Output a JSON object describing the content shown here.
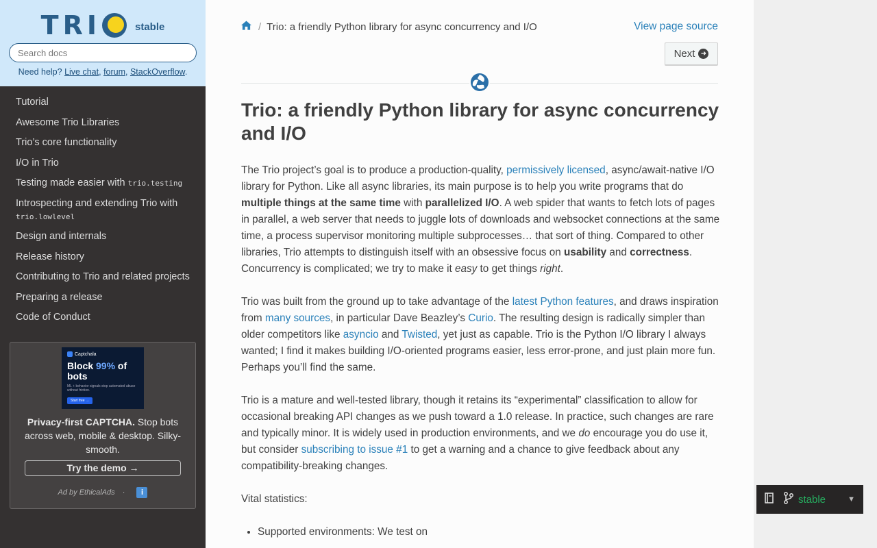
{
  "sidebar": {
    "logo_text": "TRI",
    "version": "stable",
    "search_placeholder": "Search docs",
    "help": {
      "prefix": "Need help?",
      "live_chat": "Live chat",
      "forum": "forum",
      "stackoverflow": "StackOverflow",
      "suffix": "."
    },
    "nav": [
      {
        "label": "Tutorial"
      },
      {
        "label": "Awesome Trio Libraries"
      },
      {
        "label": "Trio’s core functionality"
      },
      {
        "label": "I/O in Trio"
      },
      {
        "label": "Testing made easier with ",
        "code": "trio.testing"
      },
      {
        "label": "Introspecting and extending Trio with",
        "code": "trio.lowlevel"
      },
      {
        "label": "Design and internals"
      },
      {
        "label": "Release history"
      },
      {
        "label": "Contributing to Trio and related projects"
      },
      {
        "label": "Preparing a release"
      },
      {
        "label": "Code of Conduct"
      }
    ],
    "ad": {
      "image_brand": "Captchala",
      "image_headline_1": "Block ",
      "image_headline_hl": "99%",
      "image_headline_2": " of bots",
      "image_small": "ML + behavior signals stop automated abuse without friction.",
      "image_cta": "Start free →",
      "bold": "Privacy-first CAPTCHA.",
      "text": " Stop bots across web, mobile & desktop. Silky-smooth.",
      "button": "Try the demo →",
      "footer": "Ad by EthicalAds",
      "dot": "·",
      "info": "i"
    }
  },
  "content": {
    "breadcrumb": {
      "home_icon": "home-icon",
      "separator": "/",
      "current": "Trio: a friendly Python library for async concurrency and I/O"
    },
    "view_source": "View page source",
    "next": "Next",
    "title": "Trio: a friendly Python library for async concurrency and I/O",
    "p1": {
      "a": "The Trio project’s goal is to produce a production-quality, ",
      "link1": "permissively licensed",
      "b": ", async/await-native I/O library for Python. Like all async libraries, its main purpose is to help you write programs that do ",
      "bold1": "multiple things at the same time",
      "c": " with ",
      "bold2": "parallelized I/O",
      "d": ". A web spider that wants to fetch lots of pages in parallel, a web server that needs to juggle lots of downloads and websocket connections at the same time, a process supervisor monitoring multiple subprocesses… that sort of thing. Compared to other libraries, Trio attempts to distinguish itself with an obsessive focus on ",
      "bold3": "usability",
      "e": " and ",
      "bold4": "correctness",
      "f": ". Concurrency is complicated; we try to make it ",
      "em1": "easy",
      "g": " to get things ",
      "em2": "right",
      "h": "."
    },
    "p2": {
      "a": "Trio was built from the ground up to take advantage of the ",
      "link1": "latest Python features",
      "b": ", and draws inspiration from ",
      "link2": "many sources",
      "c": ", in particular Dave Beazley’s ",
      "link3": "Curio",
      "d": ". The resulting design is radically simpler than older competitors like ",
      "link4": "asyncio",
      "e": " and ",
      "link5": "Twisted",
      "f": ", yet just as capable. Trio is the Python I/O library I always wanted; I find it makes building I/O-oriented programs easier, less error-prone, and just plain more fun. Perhaps you’ll find the same."
    },
    "p3": {
      "a": "Trio is a mature and well-tested library, though it retains its “experimental” classification to allow for occasional breaking API changes as we push toward a 1.0 release. In practice, such changes are rare and typically minor. It is widely used in production environments, and we ",
      "em1": "do",
      "b": " encourage you do use it, but consider ",
      "link1": "subscribing to issue #1",
      "c": " to get a warning and a chance to give feedback about any compatibility-breaking changes."
    },
    "p4": "Vital statistics:",
    "bullet1": "Supported environments: We test on"
  },
  "version_badge": {
    "book_icon": "book-icon",
    "branch_icon": "git-branch-icon",
    "version": "stable",
    "caret_icon": "caret-down-icon"
  },
  "colors": {
    "link": "#2980b9",
    "sidebar_bg": "#343131",
    "sidebar_top": "#d0e8fa",
    "logo": "#2a5e89",
    "logo_sun": "#f7d31d",
    "version_green": "#27ae60"
  }
}
